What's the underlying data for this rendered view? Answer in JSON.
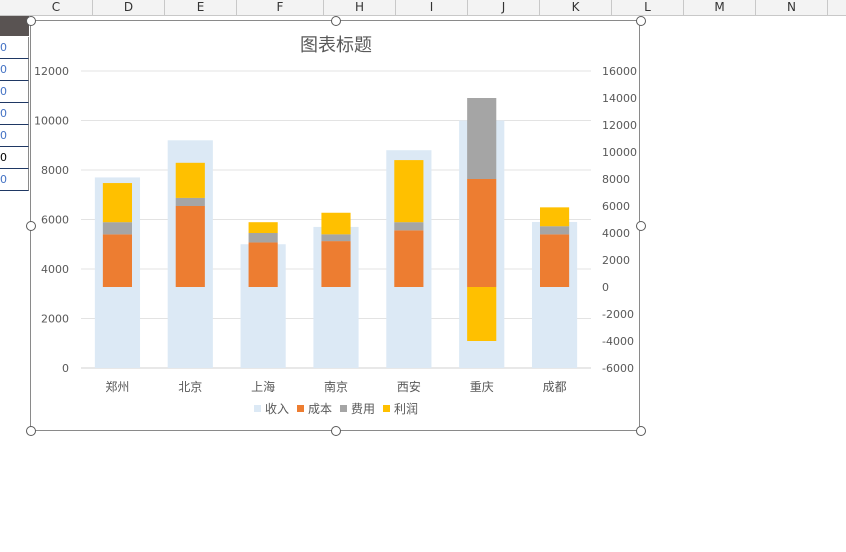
{
  "sheet": {
    "columns": [
      "C",
      "D",
      "E",
      "F",
      "H",
      "I",
      "J",
      "K",
      "L",
      "M",
      "N"
    ],
    "left_cell_fragments": [
      "0",
      "0",
      "0",
      "0",
      "0",
      "0",
      "0",
      "0"
    ]
  },
  "chart_data": {
    "type": "bar",
    "title": "图表标题",
    "categories": [
      "郑州",
      "北京",
      "上海",
      "南京",
      "西安",
      "重庆",
      "成都"
    ],
    "primary_axis": {
      "min": 0,
      "max": 12000,
      "step": 2000,
      "ticks": [
        "0",
        "2000",
        "4000",
        "6000",
        "8000",
        "10000",
        "12000"
      ]
    },
    "secondary_axis": {
      "min": -6000,
      "max": 16000,
      "step": 2000,
      "ticks": [
        "-6000",
        "-4000",
        "-2000",
        "0",
        "2000",
        "4000",
        "6000",
        "8000",
        "10000",
        "12000",
        "14000",
        "16000"
      ]
    },
    "series": [
      {
        "name": "收入",
        "axis": "primary",
        "color": "#dce9f5",
        "values": [
          7700,
          9200,
          5000,
          5700,
          8800,
          10000,
          5900
        ]
      },
      {
        "name": "成本",
        "axis": "secondary",
        "color": "#ed7d31",
        "values": [
          3900,
          6000,
          3300,
          3400,
          4200,
          8000,
          3900
        ]
      },
      {
        "name": "费用",
        "axis": "secondary",
        "color": "#a5a5a5",
        "values": [
          900,
          600,
          700,
          500,
          600,
          6000,
          600
        ]
      },
      {
        "name": "利润",
        "axis": "secondary",
        "color": "#ffc000",
        "values": [
          2900,
          2600,
          800,
          1600,
          4600,
          -4000,
          1400
        ]
      }
    ],
    "grid": true,
    "legend": "bottom"
  }
}
